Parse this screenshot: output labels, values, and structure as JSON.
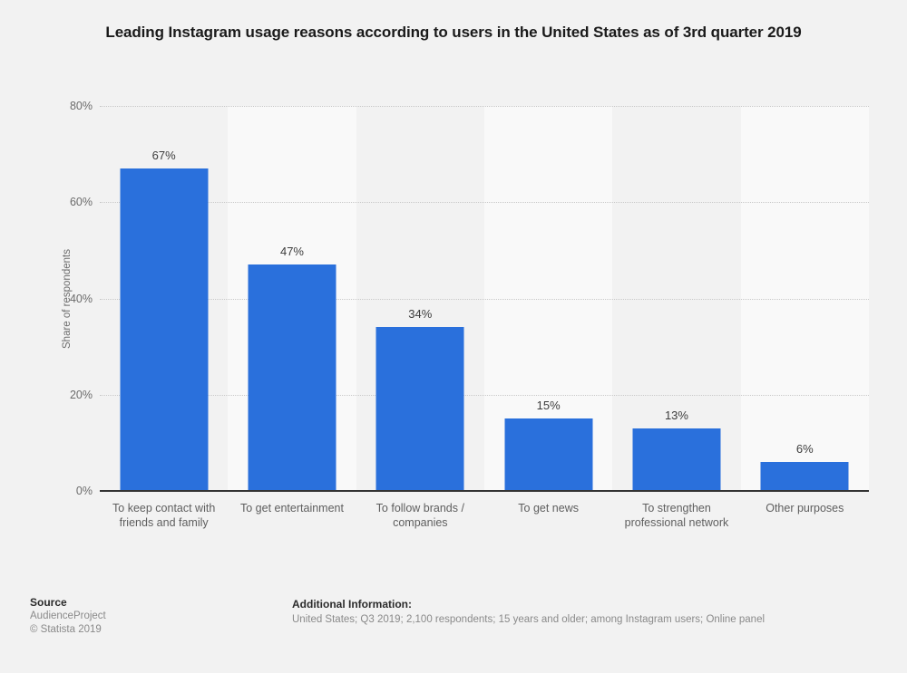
{
  "title": "Leading Instagram usage reasons according to users in the United States as of 3rd quarter 2019",
  "footer": {
    "source_label": "Source",
    "source_name": "AudienceProject",
    "copyright": "© Statista 2019",
    "additional_label": "Additional Information:",
    "additional_text": "United States; Q3 2019; 2,100 respondents; 15 years and older; among Instagram users; Online panel"
  },
  "colors": {
    "bar": "#2a70dc",
    "page_background": "#f2f2f2",
    "band_light": "#f9f9f9",
    "gridline": "#c9c9c9",
    "axis": "#333333"
  },
  "chart_data": {
    "type": "bar",
    "title": "Leading Instagram usage reasons according to users in the United States as of 3rd quarter 2019",
    "xlabel": "",
    "ylabel": "Share of respondents",
    "ylim": [
      0,
      80
    ],
    "ytick_labels": [
      "80%",
      "60%",
      "40%",
      "20%",
      "0%"
    ],
    "ytick_values": [
      80,
      60,
      40,
      20,
      0
    ],
    "grid": true,
    "legend": false,
    "categories": [
      "To keep contact with friends and family",
      "To get entertainment",
      "To follow brands / companies",
      "To get news",
      "To strengthen professional network",
      "Other purposes"
    ],
    "values": [
      67,
      47,
      34,
      15,
      13,
      6
    ],
    "value_labels": [
      "67%",
      "47%",
      "34%",
      "15%",
      "13%",
      "6%"
    ]
  }
}
